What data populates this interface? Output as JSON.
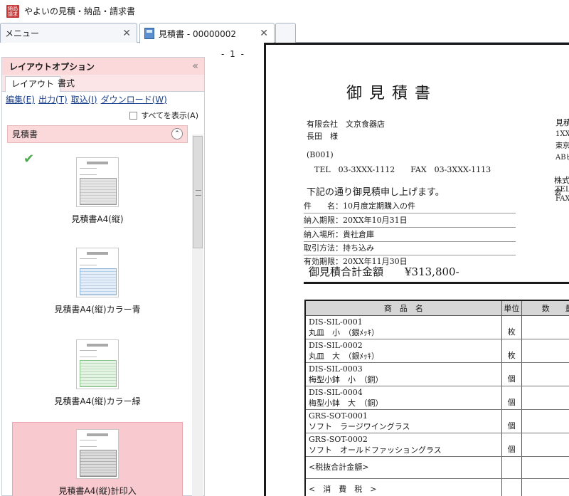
{
  "window": {
    "app_icon_text": "納品請求",
    "title": "やよいの見積・納品・請求書"
  },
  "tabs": [
    {
      "label": "メニュー",
      "close": "✕"
    },
    {
      "label": "見積書 - 00000002",
      "close": "✕"
    }
  ],
  "left_panel": {
    "title": "レイアウトオプション",
    "collapse_glyph": "«",
    "tabs": [
      "レイアウト",
      "書式"
    ],
    "links": [
      "編集(E)",
      "出力(T)",
      "取込(I)",
      "ダウンロード(W)"
    ],
    "show_all_label": "すべてを表示(A)",
    "section_label": "見積書",
    "section_toggle": "⌃",
    "templates": [
      {
        "label": "見積書A4(縦)",
        "color": "gray",
        "checked": true
      },
      {
        "label": "見積書A4(縦)カラー青",
        "color": "blue",
        "checked": false
      },
      {
        "label": "見積書A4(縦)カラー緑",
        "color": "green",
        "checked": false
      },
      {
        "label": "見積書A4(縦)計印入",
        "color": "pink",
        "checked": false,
        "selected": true
      }
    ]
  },
  "page_indicator": "- 1 -",
  "document": {
    "title": "御見積書",
    "customer_company": "有限会社　文京食器店",
    "customer_person": "長田　様",
    "customer_code": "(B001)",
    "customer_contact": "TEL　03-3XXX-1112　　FAX　03-3XXX-1113",
    "right_label_1": "見積",
    "right_addr_1": "1XX-",
    "right_addr_2": "東京",
    "right_addr_3": "ABビ",
    "right_company": "株式会",
    "right_tel": "TEL",
    "right_fax": "FAX",
    "intro": "下記の通り御見積申し上げます。",
    "subject": "件　　名：10月度定期購入の件",
    "delivery_date": "納入期限：20XX年10月31日",
    "delivery_place": "納入場所：貴社倉庫",
    "trade_method": "取引方法：持ち込み",
    "valid_until": "有効期限：20XX年11月30日",
    "total_label": "御見積合計金額　　¥313,800-",
    "table_headers": [
      "商　品　名",
      "単位",
      "数　　量"
    ],
    "items": [
      {
        "code": "DIS-SIL-0001",
        "name": "丸皿　小　（銀ﾒｯｷ）",
        "unit": "枚"
      },
      {
        "code": "DIS-SIL-0002",
        "name": "丸皿　大　（銀ﾒｯｷ）",
        "unit": "枚"
      },
      {
        "code": "DIS-SIL-0003",
        "name": "梅型小鉢　小　（銅）",
        "unit": "個"
      },
      {
        "code": "DIS-SIL-0004",
        "name": "梅型小鉢　大　（銅）",
        "unit": "個"
      },
      {
        "code": "GRS-SOT-0001",
        "name": "ソフト　ラージワイングラス",
        "unit": "個"
      },
      {
        "code": "GRS-SOT-0002",
        "name": "ソフト　オールドファッショングラス",
        "unit": "個"
      }
    ],
    "subtotal_label": "<税抜合計金額>",
    "tax_label": "<　消　費　税　>"
  }
}
